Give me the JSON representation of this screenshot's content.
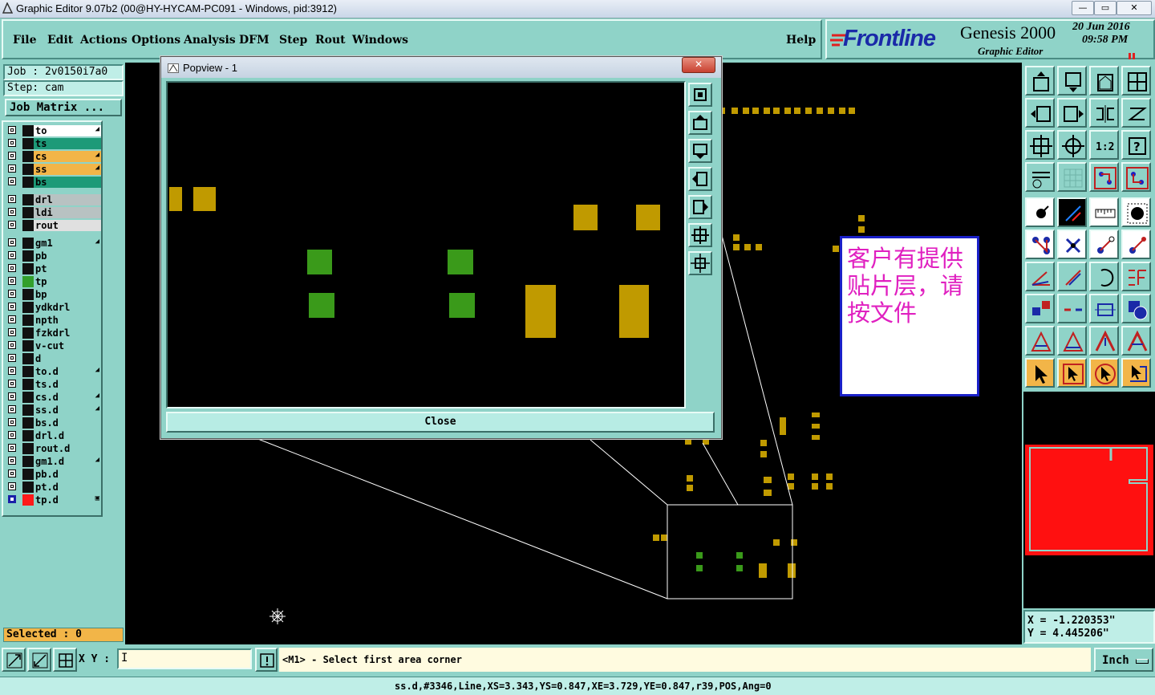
{
  "window": {
    "title": "Graphic Editor 9.07b2 (00@HY-HYCAM-PC091 - Windows, pid:3912)",
    "controls": [
      "—",
      "▭",
      "✕"
    ]
  },
  "menu": {
    "items": [
      "File",
      "Edit",
      "Actions",
      "Options",
      "Analysis",
      "DFM",
      "Step",
      "Rout",
      "Windows"
    ],
    "help": "Help"
  },
  "brand": {
    "logo": "Frontline",
    "product": "Genesis 2000",
    "subtitle": "Graphic Editor",
    "date": "20  Jun  2016",
    "time": "09:58  PM"
  },
  "job": {
    "job_label": "Job : 2v0150i7a0",
    "step_label": "Step: cam",
    "matrix_button": "Job Matrix ..."
  },
  "layers": [
    {
      "name": "to",
      "bg": "#ffffff",
      "swatch": "#111111",
      "arrow": true
    },
    {
      "name": "ts",
      "bg": "#1d9a78",
      "swatch": "#111111",
      "arrow": false
    },
    {
      "name": "cs",
      "bg": "#f2b548",
      "swatch": "#111111",
      "arrow": true
    },
    {
      "name": "ss",
      "bg": "#f2b548",
      "swatch": "#111111",
      "arrow": true
    },
    {
      "name": "bs",
      "bg": "#1d9a78",
      "swatch": "#111111",
      "arrow": false
    },
    {
      "name": "drl",
      "bg": "#b8c2c2",
      "swatch": "#111111",
      "arrow": false
    },
    {
      "name": "ldi",
      "bg": "#b8c2c2",
      "swatch": "#111111",
      "arrow": false
    },
    {
      "name": "rout",
      "bg": "#e0e0e0",
      "swatch": "#111111",
      "arrow": false
    },
    {
      "name": "gm1",
      "bg": "#8fd3c8",
      "swatch": "#111111",
      "arrow": true
    },
    {
      "name": "pb",
      "bg": "#8fd3c8",
      "swatch": "#111111",
      "arrow": false
    },
    {
      "name": "pt",
      "bg": "#8fd3c8",
      "swatch": "#111111",
      "arrow": false
    },
    {
      "name": "tp",
      "bg": "#8fd3c8",
      "swatch": "#33a02c",
      "arrow": false
    },
    {
      "name": "bp",
      "bg": "#8fd3c8",
      "swatch": "#111111",
      "arrow": false
    },
    {
      "name": "ydkdrl",
      "bg": "#8fd3c8",
      "swatch": "#111111",
      "arrow": false
    },
    {
      "name": "npth",
      "bg": "#8fd3c8",
      "swatch": "#111111",
      "arrow": false
    },
    {
      "name": "fzkdrl",
      "bg": "#8fd3c8",
      "swatch": "#111111",
      "arrow": false
    },
    {
      "name": "v-cut",
      "bg": "#8fd3c8",
      "swatch": "#111111",
      "arrow": false
    },
    {
      "name": "d",
      "bg": "#8fd3c8",
      "swatch": "#111111",
      "arrow": false
    },
    {
      "name": "to.d",
      "bg": "#8fd3c8",
      "swatch": "#111111",
      "arrow": true
    },
    {
      "name": "ts.d",
      "bg": "#8fd3c8",
      "swatch": "#111111",
      "arrow": false
    },
    {
      "name": "cs.d",
      "bg": "#8fd3c8",
      "swatch": "#111111",
      "arrow": true
    },
    {
      "name": "ss.d",
      "bg": "#8fd3c8",
      "swatch": "#111111",
      "arrow": true
    },
    {
      "name": "bs.d",
      "bg": "#8fd3c8",
      "swatch": "#111111",
      "arrow": false
    },
    {
      "name": "drl.d",
      "bg": "#8fd3c8",
      "swatch": "#111111",
      "arrow": false
    },
    {
      "name": "rout.d",
      "bg": "#8fd3c8",
      "swatch": "#111111",
      "arrow": false
    },
    {
      "name": "gm1.d",
      "bg": "#8fd3c8",
      "swatch": "#111111",
      "arrow": true
    },
    {
      "name": "pb.d",
      "bg": "#8fd3c8",
      "swatch": "#111111",
      "arrow": false
    },
    {
      "name": "pt.d",
      "bg": "#8fd3c8",
      "swatch": "#111111",
      "arrow": false
    },
    {
      "name": "tp.d",
      "bg": "#8fd3c8",
      "swatch": "#ff1a1a",
      "arrow": false,
      "active": true
    }
  ],
  "selected": "Selected : 0",
  "popview": {
    "title": "Popview - 1",
    "close_label": "Close"
  },
  "note": {
    "text": "客户有提供贴片层，请按文件",
    "color": "#e020c0"
  },
  "coords": {
    "x": "X = -1.220353\"",
    "y": "Y = 4.445206\""
  },
  "command": {
    "xy_label": "X Y :",
    "prompt": "<M1> - Select first area corner",
    "units": "Inch"
  },
  "status_line": "ss.d,#3346,Line,XS=3.343,YS=0.847,XE=3.729,YE=0.847,r39,POS,Ang=0",
  "colors": {
    "panel": "#8fd3c8",
    "pad": "#c09a00",
    "green_pad": "#3a9a1a",
    "overview": "#ff1010"
  }
}
